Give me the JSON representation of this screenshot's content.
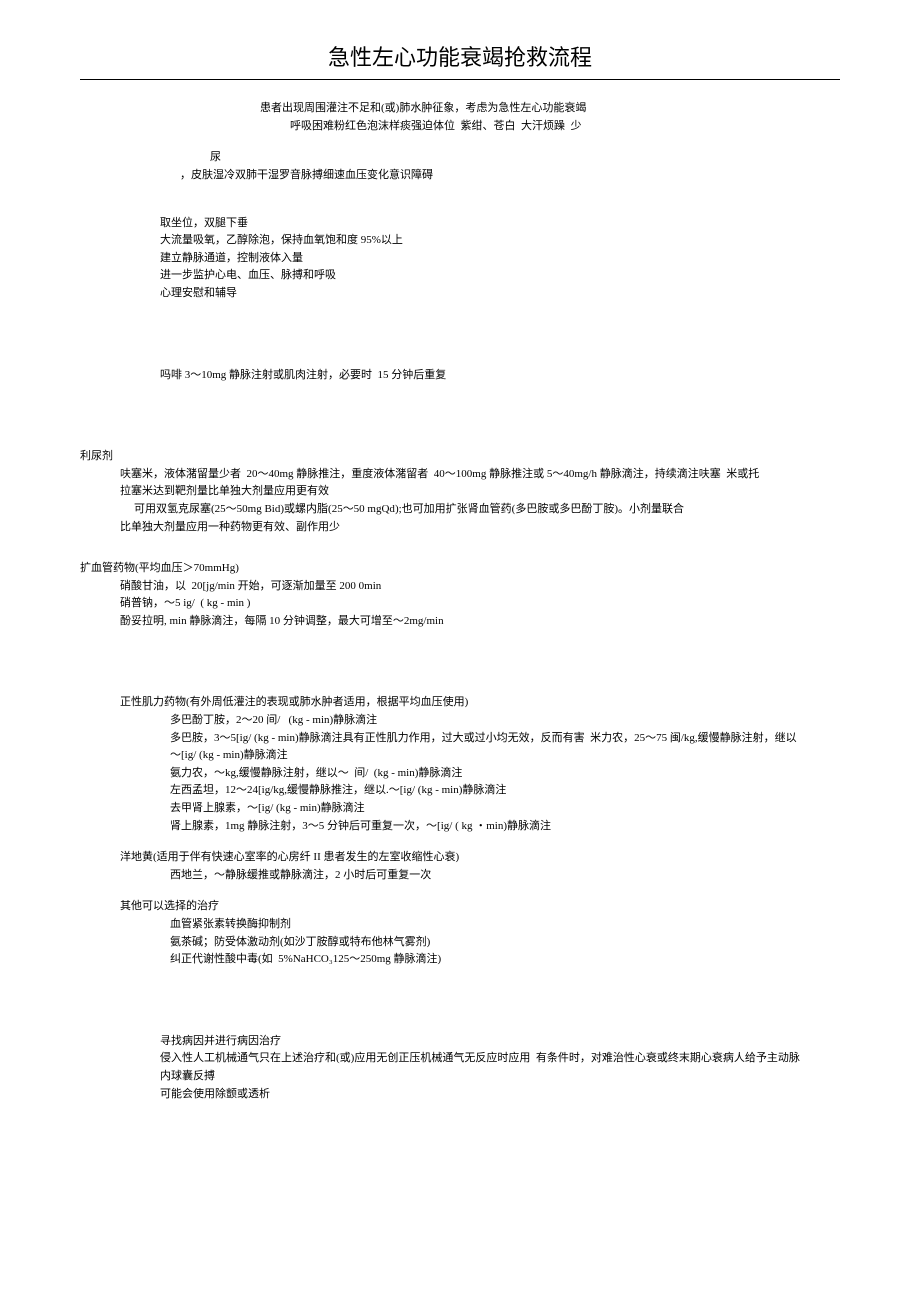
{
  "title": "急性左心功能衰竭抢救流程",
  "presentation": {
    "line1": "患者出现周围灌注不足和(或)肺水肿征象，考虑为急性左心功能衰竭",
    "line2": "呼吸困难粉红色泡沫样痰强迫体位  紫绀、苍白  大汗烦躁  少",
    "line3": "尿",
    "line4": "，皮肤湿冷双肺干湿罗音脉搏细速血压变化意识障碍"
  },
  "initial": {
    "l1": "取坐位，双腿下垂",
    "l2": "大流量吸氧，乙醇除泡，保持血氧饱和度 95%以上",
    "l3": "建立静脉通道，控制液体入量",
    "l4": "进一步监护心电、血压、脉搏和呼吸",
    "l5": "心理安慰和辅导"
  },
  "morphine": "吗啡 3～10mg 静脉注射或肌肉注射，必要时  15 分钟后重复",
  "diuretic": {
    "header": "利尿剂",
    "l1": "呋塞米，液体潴留量少者  20～40mg 静脉推注，重度液体潴留者  40～100mg 静脉推注或 5～40mg/h 静脉滴注，持续滴注呋塞  米或托",
    "l2": "拉塞米达到靶剂量比单独大剂量应用更有效",
    "l3": "可用双氢克尿塞(25～50mg Bid)或螺内脂(25～50 mgQd);也可加用扩张肾血管药(多巴胺或多巴酚丁胺)。小剂量联合",
    "l4": "比单独大剂量应用一种药物更有效、副作用少"
  },
  "vasodilator": {
    "header": "扩血管药物(平均血压＞70mmHg)",
    "l1": "硝酸甘油，以  20[jg/min 开始，可逐渐加量至 200 0min",
    "l2": "硝普钠，～5 ig/  ( kg - min )",
    "l3": "酚妥拉明, min 静脉滴注，每隔 10 分钟调整，最大可增至～2mg/min"
  },
  "inotrope": {
    "header": "正性肌力药物(有外周低灌注的表现或肺水肿者适用，根据平均血压使用)",
    "l1": "多巴酚丁胺，2～20 间/   (kg - min)静脉滴注",
    "l2": "多巴胺，3～5[ig/ (kg - min)静脉滴注具有正性肌力作用，过大或过小均无效，反而有害  米力农，25～75 闽/kg,缓慢静脉注射，继以",
    "l3": "～[ig/ (kg - min)静脉滴注",
    "l4": "氨力农，～kg,缓慢静脉注射，继以～  间/  (kg - min)静脉滴注",
    "l5": "左西孟坦，12～24[ig/kg,缓慢静脉推注，继以.～[ig/ (kg - min)静脉滴注",
    "l6": "去甲肾上腺素，～[ig/ (kg - min)静脉滴注",
    "l7": "肾上腺素，1mg 静脉注射，3～5 分钟后可重复一次，～[ig/ ( kg ・min)静脉滴注"
  },
  "digitalis": {
    "header": "洋地黄(适用于伴有快速心室率的心房纤 II 患者发生的左室收缩性心衰)",
    "l1": "西地兰，～静脉缓推或静脉滴注，2 小时后可重复一次"
  },
  "other": {
    "header": "其他可以选择的治疗",
    "l1": "血管紧张素转换酶抑制剂",
    "l2": "氨茶碱；防受体激动剂(如沙丁胺醇或特布他林气雾剂)",
    "l3": "纠正代谢性酸中毒(如  5%NaHCO₃125～250mg 静脉滴注)"
  },
  "final": {
    "l1": "寻找病因并进行病因治疗",
    "l2": "侵入性人工机械通气只在上述治疗和(或)应用无创正压机械通气无反应时应用  有条件时，对难治性心衰或终末期心衰病人给予主动脉",
    "l3": "内球囊反搏",
    "l4": "可能会使用除颤或透析"
  }
}
